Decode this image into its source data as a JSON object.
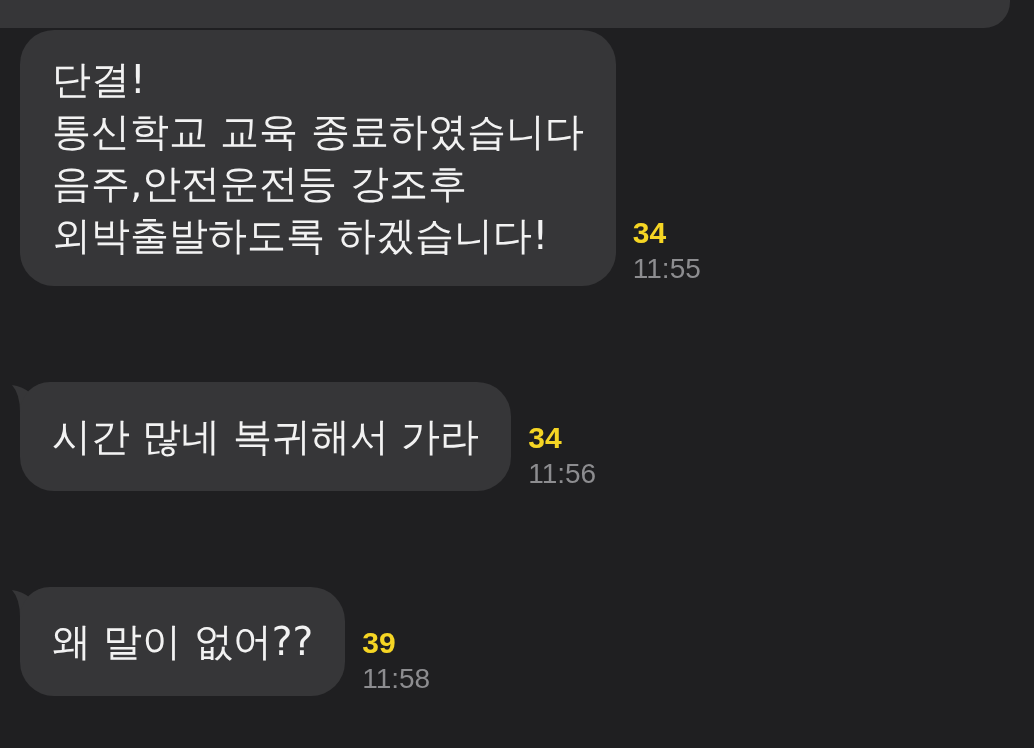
{
  "messages": [
    {
      "kind": "cut"
    },
    {
      "kind": "text",
      "tail": false,
      "text": "단결!\n통신학교 교육 종료하였습니다\n음주,안전운전등 강조후\n외박출발하도록 하겠습니다!",
      "unread_count": "34",
      "time": "11:55"
    },
    {
      "kind": "text",
      "tail": true,
      "text": "시간 많네 복귀해서 가라",
      "unread_count": "34",
      "time": "11:56"
    },
    {
      "kind": "text",
      "tail": true,
      "text": "왜 말이 없어??",
      "unread_count": "39",
      "time": "11:58"
    }
  ]
}
